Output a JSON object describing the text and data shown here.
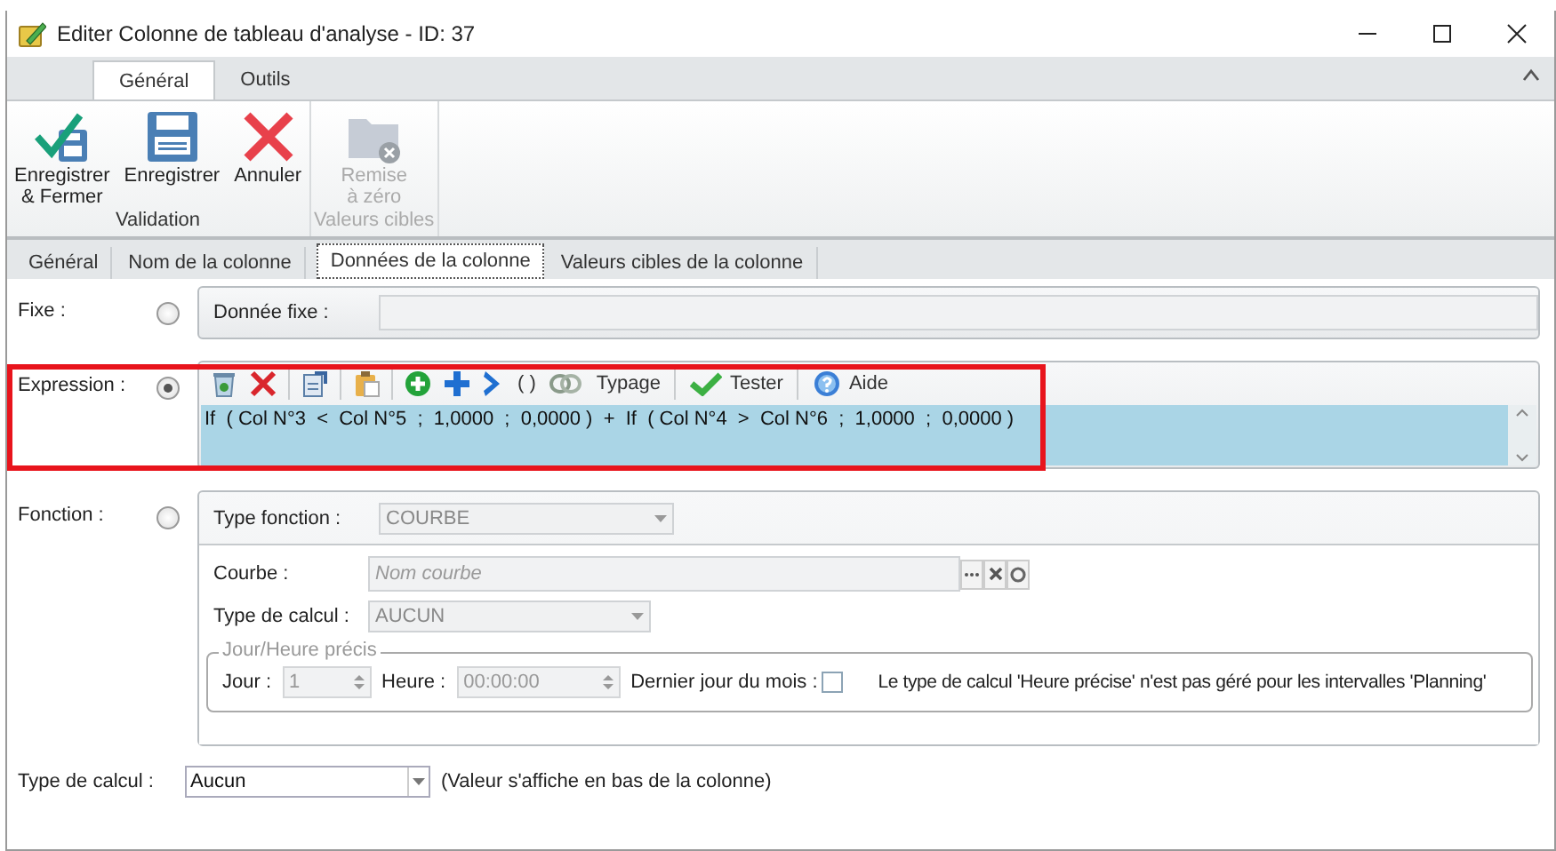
{
  "window": {
    "title": "Editer Colonne de tableau d'analyse - ID: 37"
  },
  "ribbon_tabs": [
    {
      "label": "Général",
      "selected": true
    },
    {
      "label": "Outils",
      "selected": false
    }
  ],
  "ribbon_groups": [
    {
      "label": "Validation",
      "disabled": false,
      "buttons": [
        {
          "lines": [
            "Enregistrer",
            "& Fermer"
          ]
        },
        {
          "lines": [
            "Enregistrer"
          ]
        },
        {
          "lines": [
            "Annuler"
          ]
        }
      ]
    },
    {
      "label": "Valeurs cibles",
      "disabled": true,
      "buttons": [
        {
          "lines": [
            "Remise",
            "à zéro"
          ]
        }
      ]
    }
  ],
  "tabs": [
    {
      "label": "Général",
      "selected": false
    },
    {
      "label": "Nom de la colonne",
      "selected": false
    },
    {
      "label": "Données de la colonne",
      "selected": true
    },
    {
      "label": "Valeurs cibles de la colonne",
      "selected": false
    }
  ],
  "fixe": {
    "label": "Fixe :",
    "selected": false,
    "field_label": "Donnée fixe :"
  },
  "expression": {
    "label": "Expression :",
    "selected": true,
    "highlighted": true,
    "toolbar": [
      {
        "kind": "icon"
      },
      {
        "kind": "icon"
      },
      {
        "kind": "separator"
      },
      {
        "kind": "icon"
      },
      {
        "kind": "separator"
      },
      {
        "kind": "icon"
      },
      {
        "kind": "separator"
      },
      {
        "kind": "icon"
      },
      {
        "kind": "icon"
      },
      {
        "kind": "icon"
      },
      {
        "kind": "text",
        "label": "( )"
      },
      {
        "kind": "icon"
      },
      {
        "kind": "text",
        "label": "Typage"
      },
      {
        "kind": "separator"
      },
      {
        "kind": "icon",
        "label": "Tester"
      },
      {
        "kind": "separator"
      },
      {
        "kind": "icon",
        "label": "Aide"
      }
    ],
    "value": "If  ( Col N°3  <  Col N°5  ;  1,0000  ;  0,0000 )  +  If  ( Col N°4  >  Col N°6  ;  1,0000  ;  0,0000 )"
  },
  "fonction": {
    "label": "Fonction :",
    "selected": false,
    "type_label": "Type fonction :",
    "type_value": "COURBE",
    "courbe_label": "Courbe :",
    "courbe_placeholder": "Nom courbe",
    "calc_label": "Type de calcul :",
    "calc_value": "AUCUN",
    "group_title": "Jour/Heure précis",
    "jour_label": "Jour :",
    "jour_value": "1",
    "heure_label": "Heure :",
    "heure_value": "00:00:00",
    "last_day_label": "Dernier jour du mois :",
    "last_day_checked": false,
    "note": "Le type de calcul 'Heure précise' n'est pas géré pour les intervalles 'Planning'"
  },
  "footer": {
    "label": "Type de calcul :",
    "value": "Aucun",
    "hint": "(Valeur s'affiche en bas de la colonne)"
  }
}
